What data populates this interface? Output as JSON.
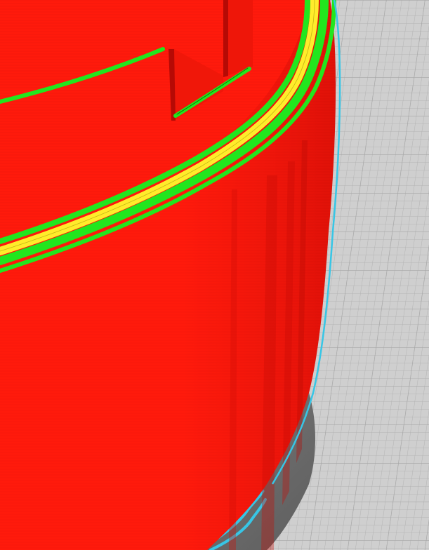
{
  "viewport": {
    "background": "#cfcfcf",
    "grid_line_color": "#b3b3b3",
    "grid_major_color": "#a5a5a5"
  },
  "print_preview": {
    "colors": {
      "outer_wall": "#ff1a0c",
      "outer_wall_shade": "#d90d08",
      "inner_wall": "#22e61e",
      "infill_skin": "#ffec2b",
      "skirt": "#37c6e6",
      "shadow": "#6f6f6f"
    }
  }
}
